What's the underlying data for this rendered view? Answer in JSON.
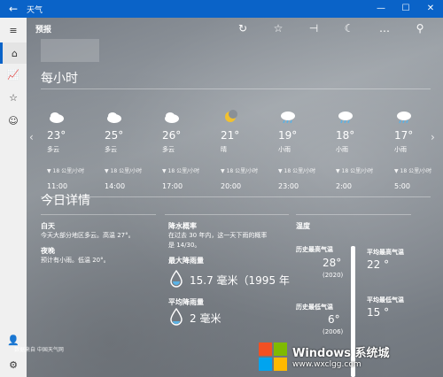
{
  "titlebar": {
    "back": "←",
    "title": "天气",
    "minimize": "—",
    "maximize": "☐",
    "close": "✕"
  },
  "sidebar": {
    "menu": "≡",
    "home": "⌂",
    "chart": "📈",
    "favorites": "☆",
    "smiley": "☺",
    "account": "👤",
    "settings": "⚙"
  },
  "toolbar": {
    "label": "预报",
    "refresh": "↻",
    "favorite": "☆",
    "pin": "⊣",
    "dark": "☾",
    "more": "…",
    "search": "⚲"
  },
  "hourly": {
    "title": "每小时",
    "items": [
      {
        "temp": "23°",
        "cond": "多云",
        "wind": "▼ 18 公里/小时",
        "time": "11:00",
        "icon": "cloudy-icon"
      },
      {
        "temp": "25°",
        "cond": "多云",
        "wind": "▼ 18 公里/小时",
        "time": "14:00",
        "icon": "cloudy-icon"
      },
      {
        "temp": "26°",
        "cond": "多云",
        "wind": "▼ 18 公里/小时",
        "time": "17:00",
        "icon": "cloudy-icon"
      },
      {
        "temp": "21°",
        "cond": "晴",
        "wind": "▼ 18 公里/小时",
        "time": "20:00",
        "icon": "moon-icon"
      },
      {
        "temp": "19°",
        "cond": "小雨",
        "wind": "▼ 18 公里/小时",
        "time": "23:00",
        "icon": "rain-icon"
      },
      {
        "temp": "18°",
        "cond": "小雨",
        "wind": "▼ 18 公里/小时",
        "time": "2:00",
        "icon": "rain-icon"
      },
      {
        "temp": "17°",
        "cond": "小雨",
        "wind": "▼ 18 公里/小时",
        "time": "5:00",
        "icon": "rain-icon"
      }
    ],
    "prev": "‹",
    "next": "›"
  },
  "details": {
    "title": "今日详情",
    "day_label": "白天",
    "day_text": "今天大部分地区多云。高温 27°。",
    "night_label": "夜晚",
    "night_text": "预计有小雨。低温 20°。",
    "rain_prob_label": "降水概率",
    "rain_prob_text1": "在过去 30 年内，这一天下雨的概率",
    "rain_prob_text2": "是 14/30。",
    "max_rain_label": "最大降雨量",
    "max_rain_value": "15.7 毫米（1995 年",
    "avg_rain_label": "平均降雨量",
    "avg_rain_value": "2 毫米",
    "temp_label": "温度",
    "hist_high_label": "历史最高气温",
    "hist_high_value": "28°",
    "hist_high_year": "(2020)",
    "avg_high_label": "平均最高气温",
    "avg_high_value": "22 °",
    "hist_low_label": "历史最低气温",
    "hist_low_value": "6°",
    "hist_low_year": "(2006)",
    "avg_low_label": "平均最低气温",
    "avg_low_value": "15 °"
  },
  "source": "数据来自 中国天气网",
  "watermark": {
    "title": "Windows 系统城",
    "url": "www.wxclgg.com"
  }
}
